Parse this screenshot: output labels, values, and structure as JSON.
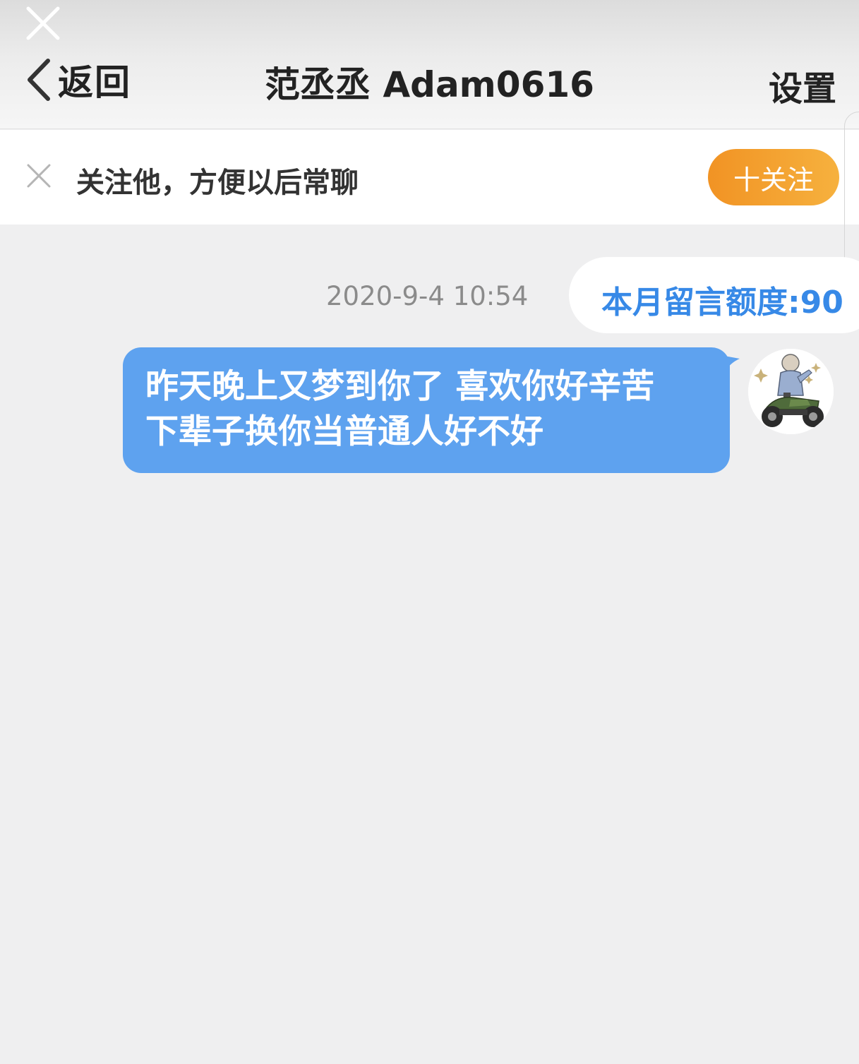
{
  "header": {
    "back_label": "返回",
    "title": "范丞丞 Adam0616",
    "settings_label": "设置"
  },
  "follow_bar": {
    "prompt": "关注他，方便以后常聊",
    "follow_button": "十关注"
  },
  "chat": {
    "timestamp": "2020-9-4 10:54",
    "quota": "本月留言额度:90",
    "message_lines": [
      "昨天晚上又梦到你了 喜欢你好辛苦",
      "下辈子换你当普通人好不好"
    ]
  },
  "colors": {
    "accent_blue": "#3789e7",
    "bubble_blue": "#5ea2ef",
    "follow_orange": "#f19324"
  },
  "icons": {
    "close": "close-icon",
    "back": "chevron-left-icon",
    "dismiss": "dismiss-x-icon",
    "avatar": "user-avatar"
  }
}
